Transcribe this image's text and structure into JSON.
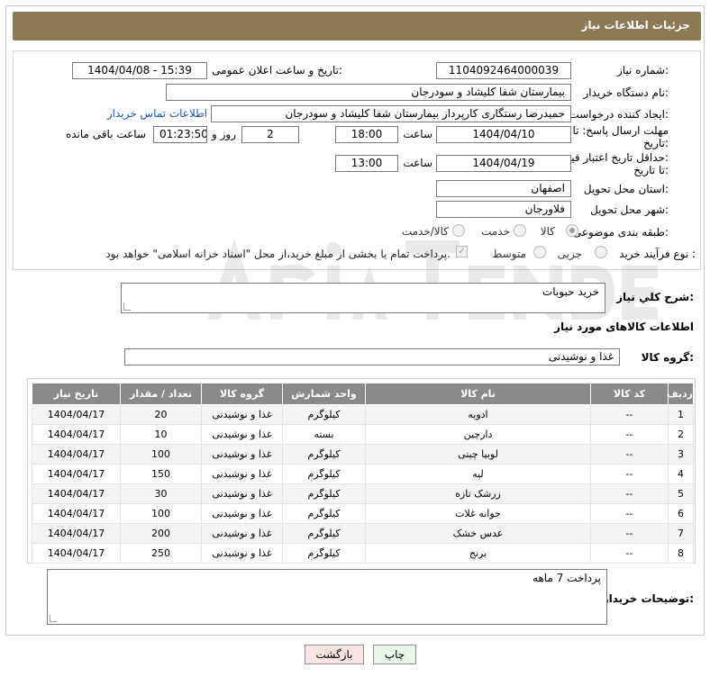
{
  "header": {
    "title": "جزئیات اطلاعات نیاز"
  },
  "need_number": {
    "label": "شماره نیاز:",
    "value": "1104092464000039"
  },
  "announce_datetime": {
    "label": "تاریخ و ساعت اعلان عمومی:",
    "value": "1404/04/08 - 15:39"
  },
  "buyer_org": {
    "label": "نام دستگاه خریدار:",
    "value": "بیمارستان شفا کلیشاد و سودرجان"
  },
  "requester": {
    "label": "ایجاد کننده درخواست:",
    "value": "حمیدرضا رستگاری کارپرداز بیمارستان شفا کلیشاد و سودرجان",
    "contact_link": "اطلاعات تماس خریدار"
  },
  "response_deadline": {
    "label_line1": "مهلت ارسال پاسخ: تا",
    "label_line2": "تاریخ:",
    "date": "1404/04/10",
    "time_label": "ساعت",
    "time": "18:00",
    "days": "2",
    "days_label": "روز و",
    "remaining": "01:23:50",
    "remaining_label": "ساعت باقی مانده"
  },
  "price_validity": {
    "label_line1": "حداقل تاریخ اعتبار قیمت:",
    "label_line2": "تا تاریخ:",
    "date": "1404/04/19",
    "time_label": "ساعت",
    "time": "13:00"
  },
  "delivery_province": {
    "label": "استان محل تحویل:",
    "value": "اصفهان"
  },
  "delivery_city": {
    "label": "شهر محل تحویل:",
    "value": "فلاورجان"
  },
  "category": {
    "label": "طبقه بندی موضوعی:",
    "options": [
      "کالا",
      "خدمت",
      "کالا/خدمت"
    ],
    "selected": "کالا"
  },
  "process_type": {
    "label": "نوع فرآیند خرید :",
    "options": [
      "جزیی",
      "متوسط"
    ],
    "payment_note": "پرداخت تمام یا بخشی از مبلغ خرید،از محل \"اسناد خزانه اسلامی\" خواهد بود."
  },
  "description": {
    "label": "شرح کلي نياز:",
    "value": "خرید حبوبات"
  },
  "goods_info": {
    "title": "اطلاعات کالاهای مورد نیاز"
  },
  "goods_group": {
    "label": "گروه کالا:",
    "value": "غذا و نوشیدنی"
  },
  "table": {
    "headers": [
      "ردیف",
      "کد کالا",
      "نام کالا",
      "واحد شمارش",
      "گروه کالا",
      "تعداد / مقدار",
      "تاریخ نیاز"
    ],
    "rows": [
      [
        "1",
        "--",
        "ادویه",
        "کیلوگرم",
        "غذا و نوشیدنی",
        "20",
        "1404/04/17"
      ],
      [
        "2",
        "--",
        "دارچین",
        "بسته",
        "غذا و نوشیدنی",
        "10",
        "1404/04/17"
      ],
      [
        "3",
        "--",
        "لوبیا چیتی",
        "کیلوگرم",
        "غذا و نوشیدنی",
        "100",
        "1404/04/17"
      ],
      [
        "4",
        "--",
        "لپه",
        "کیلوگرم",
        "غذا و نوشیدنی",
        "150",
        "1404/04/17"
      ],
      [
        "5",
        "--",
        "زرشک تازه",
        "کیلوگرم",
        "غذا و نوشیدنی",
        "30",
        "1404/04/17"
      ],
      [
        "6",
        "--",
        "جوانه غلات",
        "کیلوگرم",
        "غذا و نوشیدنی",
        "100",
        "1404/04/17"
      ],
      [
        "7",
        "--",
        "عدس خشک",
        "کیلوگرم",
        "غذا و نوشیدنی",
        "200",
        "1404/04/17"
      ],
      [
        "8",
        "--",
        "برنج",
        "کیلوگرم",
        "غذا و نوشیدنی",
        "250",
        "1404/04/17"
      ]
    ]
  },
  "buyer_notes": {
    "label": "توضیحات خریدار:",
    "value": "پرداخت 7 ماهه"
  },
  "buttons": {
    "print": "چاپ",
    "back": "بازگشت"
  },
  "colors": {
    "header_bg": "#8c7a55",
    "table_header_bg": "#8a8a8a",
    "link": "#1b57b0"
  }
}
